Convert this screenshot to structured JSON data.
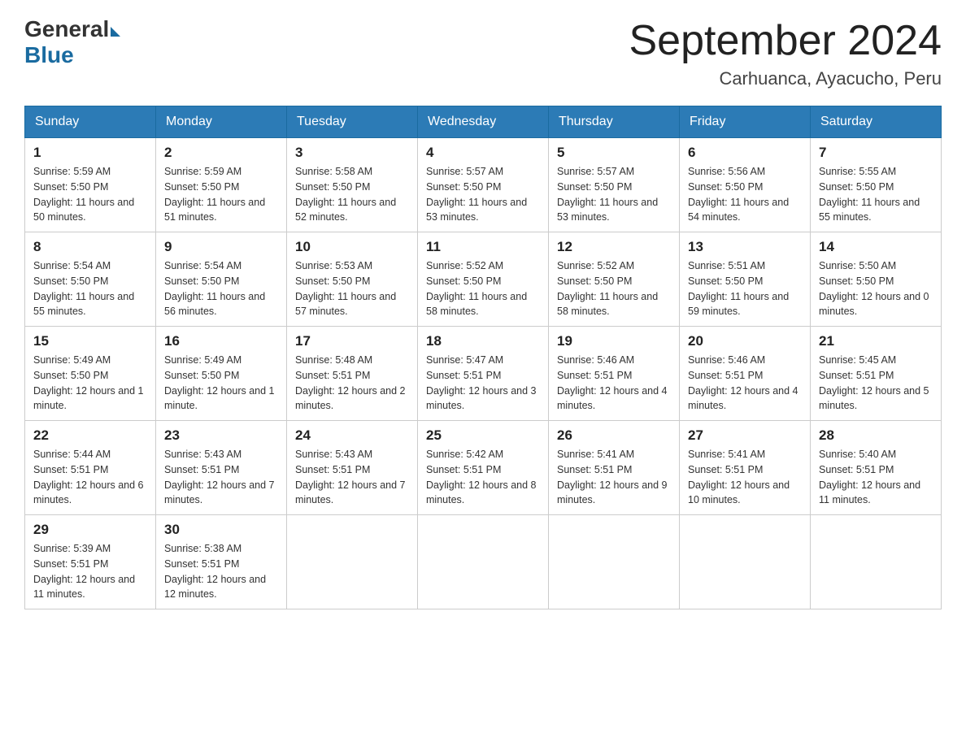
{
  "header": {
    "logo_general": "General",
    "logo_blue": "Blue",
    "month_title": "September 2024",
    "location": "Carhuanca, Ayacucho, Peru"
  },
  "days_header": [
    "Sunday",
    "Monday",
    "Tuesday",
    "Wednesday",
    "Thursday",
    "Friday",
    "Saturday"
  ],
  "weeks": [
    [
      {
        "day": "1",
        "sunrise": "5:59 AM",
        "sunset": "5:50 PM",
        "daylight": "11 hours and 50 minutes."
      },
      {
        "day": "2",
        "sunrise": "5:59 AM",
        "sunset": "5:50 PM",
        "daylight": "11 hours and 51 minutes."
      },
      {
        "day": "3",
        "sunrise": "5:58 AM",
        "sunset": "5:50 PM",
        "daylight": "11 hours and 52 minutes."
      },
      {
        "day": "4",
        "sunrise": "5:57 AM",
        "sunset": "5:50 PM",
        "daylight": "11 hours and 53 minutes."
      },
      {
        "day": "5",
        "sunrise": "5:57 AM",
        "sunset": "5:50 PM",
        "daylight": "11 hours and 53 minutes."
      },
      {
        "day": "6",
        "sunrise": "5:56 AM",
        "sunset": "5:50 PM",
        "daylight": "11 hours and 54 minutes."
      },
      {
        "day": "7",
        "sunrise": "5:55 AM",
        "sunset": "5:50 PM",
        "daylight": "11 hours and 55 minutes."
      }
    ],
    [
      {
        "day": "8",
        "sunrise": "5:54 AM",
        "sunset": "5:50 PM",
        "daylight": "11 hours and 55 minutes."
      },
      {
        "day": "9",
        "sunrise": "5:54 AM",
        "sunset": "5:50 PM",
        "daylight": "11 hours and 56 minutes."
      },
      {
        "day": "10",
        "sunrise": "5:53 AM",
        "sunset": "5:50 PM",
        "daylight": "11 hours and 57 minutes."
      },
      {
        "day": "11",
        "sunrise": "5:52 AM",
        "sunset": "5:50 PM",
        "daylight": "11 hours and 58 minutes."
      },
      {
        "day": "12",
        "sunrise": "5:52 AM",
        "sunset": "5:50 PM",
        "daylight": "11 hours and 58 minutes."
      },
      {
        "day": "13",
        "sunrise": "5:51 AM",
        "sunset": "5:50 PM",
        "daylight": "11 hours and 59 minutes."
      },
      {
        "day": "14",
        "sunrise": "5:50 AM",
        "sunset": "5:50 PM",
        "daylight": "12 hours and 0 minutes."
      }
    ],
    [
      {
        "day": "15",
        "sunrise": "5:49 AM",
        "sunset": "5:50 PM",
        "daylight": "12 hours and 1 minute."
      },
      {
        "day": "16",
        "sunrise": "5:49 AM",
        "sunset": "5:50 PM",
        "daylight": "12 hours and 1 minute."
      },
      {
        "day": "17",
        "sunrise": "5:48 AM",
        "sunset": "5:51 PM",
        "daylight": "12 hours and 2 minutes."
      },
      {
        "day": "18",
        "sunrise": "5:47 AM",
        "sunset": "5:51 PM",
        "daylight": "12 hours and 3 minutes."
      },
      {
        "day": "19",
        "sunrise": "5:46 AM",
        "sunset": "5:51 PM",
        "daylight": "12 hours and 4 minutes."
      },
      {
        "day": "20",
        "sunrise": "5:46 AM",
        "sunset": "5:51 PM",
        "daylight": "12 hours and 4 minutes."
      },
      {
        "day": "21",
        "sunrise": "5:45 AM",
        "sunset": "5:51 PM",
        "daylight": "12 hours and 5 minutes."
      }
    ],
    [
      {
        "day": "22",
        "sunrise": "5:44 AM",
        "sunset": "5:51 PM",
        "daylight": "12 hours and 6 minutes."
      },
      {
        "day": "23",
        "sunrise": "5:43 AM",
        "sunset": "5:51 PM",
        "daylight": "12 hours and 7 minutes."
      },
      {
        "day": "24",
        "sunrise": "5:43 AM",
        "sunset": "5:51 PM",
        "daylight": "12 hours and 7 minutes."
      },
      {
        "day": "25",
        "sunrise": "5:42 AM",
        "sunset": "5:51 PM",
        "daylight": "12 hours and 8 minutes."
      },
      {
        "day": "26",
        "sunrise": "5:41 AM",
        "sunset": "5:51 PM",
        "daylight": "12 hours and 9 minutes."
      },
      {
        "day": "27",
        "sunrise": "5:41 AM",
        "sunset": "5:51 PM",
        "daylight": "12 hours and 10 minutes."
      },
      {
        "day": "28",
        "sunrise": "5:40 AM",
        "sunset": "5:51 PM",
        "daylight": "12 hours and 11 minutes."
      }
    ],
    [
      {
        "day": "29",
        "sunrise": "5:39 AM",
        "sunset": "5:51 PM",
        "daylight": "12 hours and 11 minutes."
      },
      {
        "day": "30",
        "sunrise": "5:38 AM",
        "sunset": "5:51 PM",
        "daylight": "12 hours and 12 minutes."
      },
      null,
      null,
      null,
      null,
      null
    ]
  ],
  "labels": {
    "sunrise": "Sunrise:",
    "sunset": "Sunset:",
    "daylight": "Daylight:"
  }
}
